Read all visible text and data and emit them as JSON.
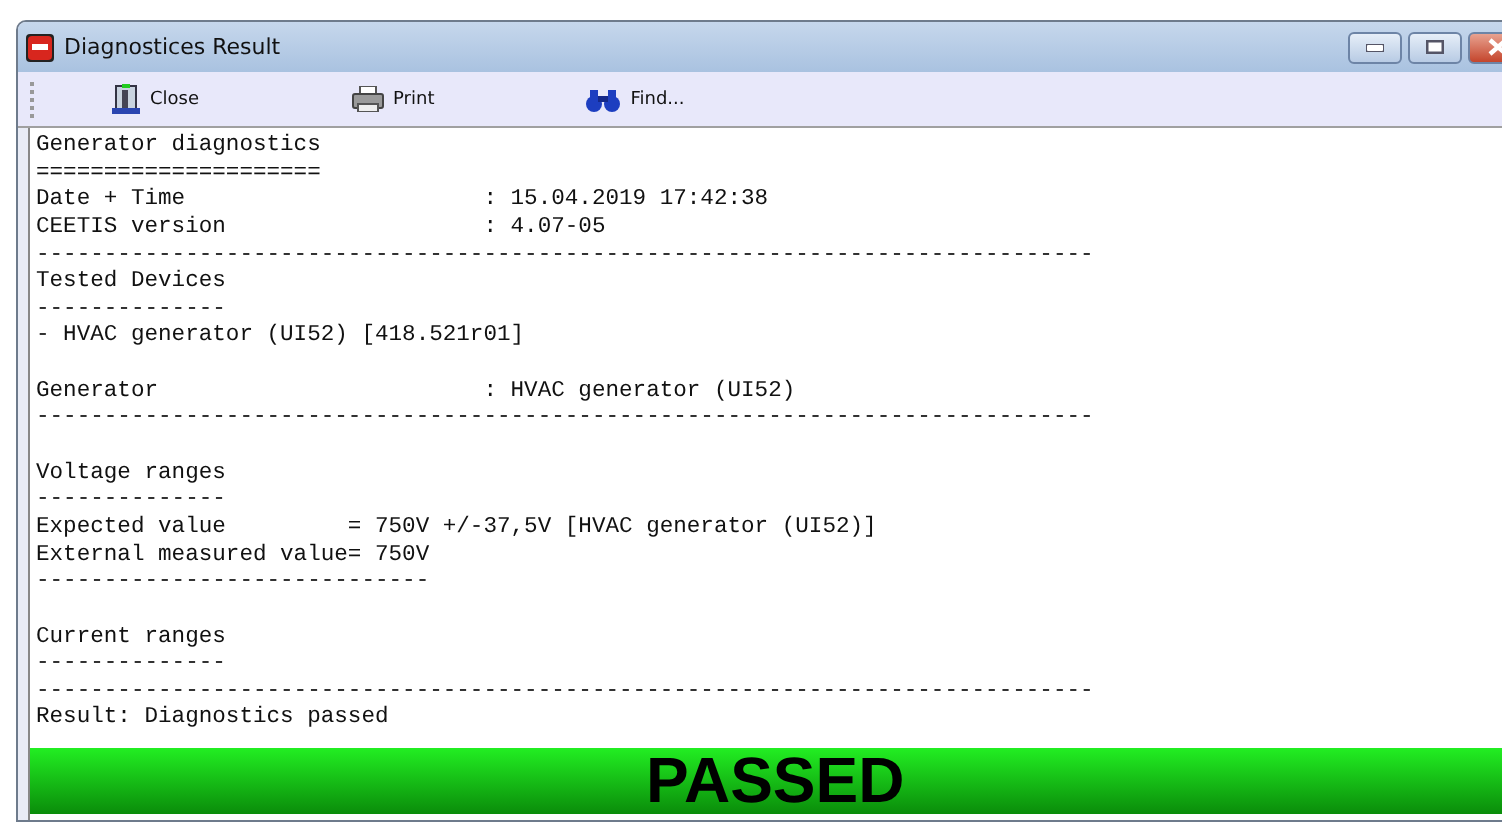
{
  "window": {
    "title": "Diagnostices Result"
  },
  "toolbar": [
    {
      "kind": "close",
      "label": "Close"
    },
    {
      "kind": "print",
      "label": "Print"
    },
    {
      "kind": "find",
      "label": "Find..."
    }
  ],
  "report_lines": [
    {
      "kind": "text",
      "text": "Generator diagnostics"
    },
    {
      "kind": "text",
      "text": "====================="
    },
    {
      "kind": "text",
      "text": "Date + Time                      : 15.04.2019 17:42:38"
    },
    {
      "kind": "text",
      "text": "CEETIS version                   : 4.07-05"
    },
    {
      "kind": "text",
      "text": "------------------------------------------------------------------------------"
    },
    {
      "kind": "text",
      "text": "Tested Devices"
    },
    {
      "kind": "text",
      "text": "--------------"
    },
    {
      "kind": "text",
      "text": "- HVAC generator (UI52) [418.521r01]"
    },
    {
      "kind": "blank"
    },
    {
      "kind": "text",
      "text": "Generator                        : HVAC generator (UI52)"
    },
    {
      "kind": "text",
      "text": "------------------------------------------------------------------------------"
    },
    {
      "kind": "blank"
    },
    {
      "kind": "text",
      "text": "Voltage ranges"
    },
    {
      "kind": "text",
      "text": "--------------"
    },
    {
      "kind": "text",
      "text": "Expected value         = 750V +/-37,5V [HVAC generator (UI52)]"
    },
    {
      "kind": "text",
      "text": "External measured value= 750V"
    },
    {
      "kind": "text",
      "text": "-----------------------------"
    },
    {
      "kind": "blank"
    },
    {
      "kind": "text",
      "text": "Current ranges"
    },
    {
      "kind": "text",
      "text": "--------------"
    },
    {
      "kind": "text",
      "text": "------------------------------------------------------------------------------"
    },
    {
      "kind": "text",
      "text": "Result: Diagnostics passed"
    }
  ],
  "result_banner": {
    "text": "PASSED"
  }
}
